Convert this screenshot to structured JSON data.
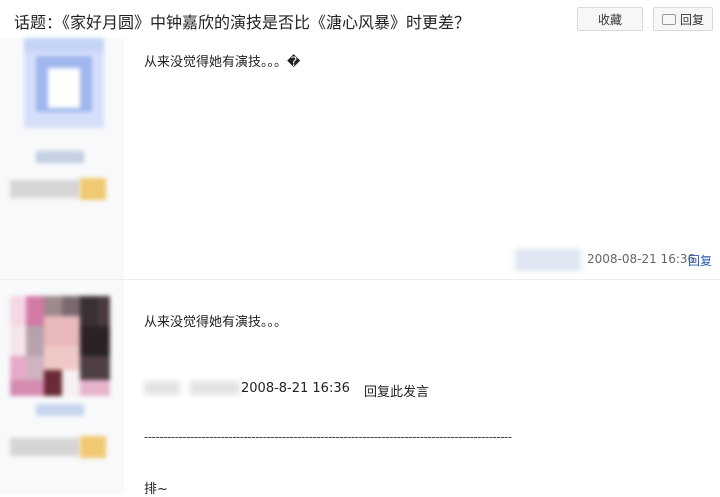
{
  "header": {
    "title": "话题：《家好月圆》中钟嘉欣的演技是否比《溏心风暴》时更差？",
    "favorite_label": "收藏",
    "reply_label": "回复"
  },
  "posts": [
    {
      "content": "从来没觉得她有演技。。。�",
      "timestamp": "2008-08-21 16:36",
      "reply_label": "回复"
    },
    {
      "content": "从来没觉得她有演技。。。",
      "quote_time": "2008-8-21 16:36",
      "quote_reply": "回复此发言",
      "divider": "------------------------------------------------------------------------------------------------",
      "body": "排~"
    }
  ],
  "colors": {
    "link": "#2b5bb5",
    "user_col_bg": "#f8f9fb",
    "border": "#e6e6e6"
  }
}
